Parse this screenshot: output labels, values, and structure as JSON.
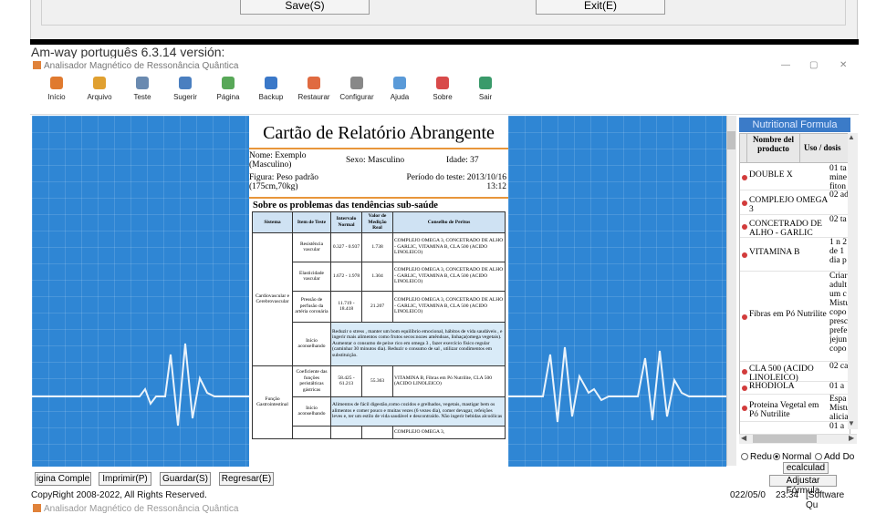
{
  "top_window": {
    "save_label": "Save(S)",
    "exit_label": "Exit(E)"
  },
  "caption": "Am-way português 6.3.14 versión:",
  "app_title": "Analisador Magnético de Ressonância Quântica",
  "toolbar": [
    {
      "label": "Início",
      "icon": "home-icon",
      "color": "#e07a2f"
    },
    {
      "label": "Arquivo",
      "icon": "users-icon",
      "color": "#e0a030"
    },
    {
      "label": "Teste",
      "icon": "test-icon",
      "color": "#6a8ab0"
    },
    {
      "label": "Sugerir",
      "icon": "shield-icon",
      "color": "#4a7fc0"
    },
    {
      "label": "Página",
      "icon": "page-icon",
      "color": "#58a858"
    },
    {
      "label": "Backup",
      "icon": "backup-icon",
      "color": "#3a78c8"
    },
    {
      "label": "Restaurar",
      "icon": "restore-icon",
      "color": "#e06a40"
    },
    {
      "label": "Configurar",
      "icon": "tools-icon",
      "color": "#888888"
    },
    {
      "label": "Ajuda",
      "icon": "help-icon",
      "color": "#5a9ad8"
    },
    {
      "label": "Sobre",
      "icon": "about-icon",
      "color": "#d84a4a"
    },
    {
      "label": "Sair",
      "icon": "exit-icon",
      "color": "#3a9a6a"
    }
  ],
  "report": {
    "title": "Cartão de Relatório Abrangente",
    "name": "Nome: Exemplo (Masculino)",
    "sex": "Sexo: Masculino",
    "age": "Idade: 37",
    "figure": "Figura: Peso padrão (175cm,70kg)",
    "period": "Período do teste: 2013/10/16 13:12",
    "subheading": "Sobre os problemas das tendências sub-saúde",
    "columns": [
      "Sistema",
      "Item de Teste",
      "Intervalo Normal",
      "Valor de Medição Real",
      "Conselho de Peritos"
    ],
    "system1": "Cardiovascular e Cerebrovascular",
    "system2": "Função Gastrointestinal",
    "rows": [
      {
        "item": "Resistência vascular",
        "normal": "0.327 - 0.937",
        "value": "1.738",
        "advice": "COMPLEJO OMEGA 3, CONCETRADO DE ALHO - GARLIC, VITAMINA B, CLA 500 (ACIDO LINOLEICO)"
      },
      {
        "item": "Elasticidade vascular",
        "normal": "1.672 - 1.978",
        "value": "1.304",
        "advice": "COMPLEJO OMEGA 3, CONCETRADO DE ALHO - GARLIC, VITAMINA B, CLA 500 (ACIDO LINOLEICO)"
      },
      {
        "item": "Pressão de perfusão da artéria coronária",
        "normal": "11.719 - 18.418",
        "value": "21.207",
        "advice": "COMPLEJO OMEGA 3, CONCETRADO DE ALHO - GARLIC, VITAMINA B, CLA 500 (ACIDO LINOLEICO)"
      }
    ],
    "start1_label": "Início aconselhando",
    "start1_text": "Reduzir o stress , manter um bom equilíbrio emocional, hábitos de vida saudáveis , e ingerir mais alimentos como frutos secos:nozes amêndoas, linhaça(omega vegetais). Aumentar o consumo de peixe rico em omega 3 , fazer exercício físico regular (caminhar 30 minutos dia). Reduzir o consumo de sal , utilizar condimentos em substituição.",
    "row4": {
      "item": "Coeficiente das funções peristálticas gástricas",
      "normal": "58.425 - 61.213",
      "value": "55.363",
      "advice": "VITAMINA B, Fibras em Pó Nutrilite, CLA 500 (ACIDO LINOLEICO)"
    },
    "start2_label": "Início aconselhando",
    "start2_text": "Alimentos de fácil digestão,como cozidos e grelhados, vegetais, mastigar bem os alimentos e comer pouco e muitas vezes (6 vezes dia), comer devagar, refeições leves e, ter um estilo de vida saudável e descontraído. Não ingerir bebidas alcoólicas",
    "row5_advice": "COMPLEJO OMEGA 3,"
  },
  "nutrition": {
    "header": "Nutritional Formula",
    "col_product": "Nombre del producto",
    "col_use": "Uso / dosis",
    "items": [
      {
        "product": "DOUBLE X",
        "use": "01 ta\nmine\nfiton"
      },
      {
        "product": "COMPLEJO OMEGA 3",
        "use": "02 ad"
      },
      {
        "product": "CONCETRADO DE ALHO - GARLIC",
        "use": "02 ta"
      },
      {
        "product": "VITAMINA B",
        "use": "1 n 2\nde 1\ndia p"
      },
      {
        "product": "Fibras em Pó Nutrilite",
        "use": "Criar\nadult\num c\nMistu\ncopo\npresc\nprefe\njejun\ncopo"
      },
      {
        "product": "CLA 500 (ACIDO LINOLEICO)",
        "use": "02 ca"
      },
      {
        "product": "RHODIOLA",
        "use": "01 a"
      },
      {
        "product": "Proteina Vegetal em Pó Nutrilite",
        "use": "Espa\nMistu\nalicia"
      },
      {
        "product": "",
        "use": "01 a"
      }
    ],
    "radio_reduce": "Redu",
    "radio_normal": "Normal",
    "radio_add": "Add Do",
    "recalc_label": "ecalculad",
    "adjust_label": "Adjustar Fórmula"
  },
  "bottom_buttons": {
    "complete": "igina Comple",
    "print": "Imprimir(P)",
    "save": "Guardar(S)",
    "back": "Regresar(E)"
  },
  "status": {
    "copyright": "CopyRight 2008-2022, All Rights Reserved.",
    "date": "022/05/0",
    "time": "23:34",
    "software": "[Software Qu"
  },
  "bottom_title": "Analisador Magnético de Ressonância Quântica"
}
